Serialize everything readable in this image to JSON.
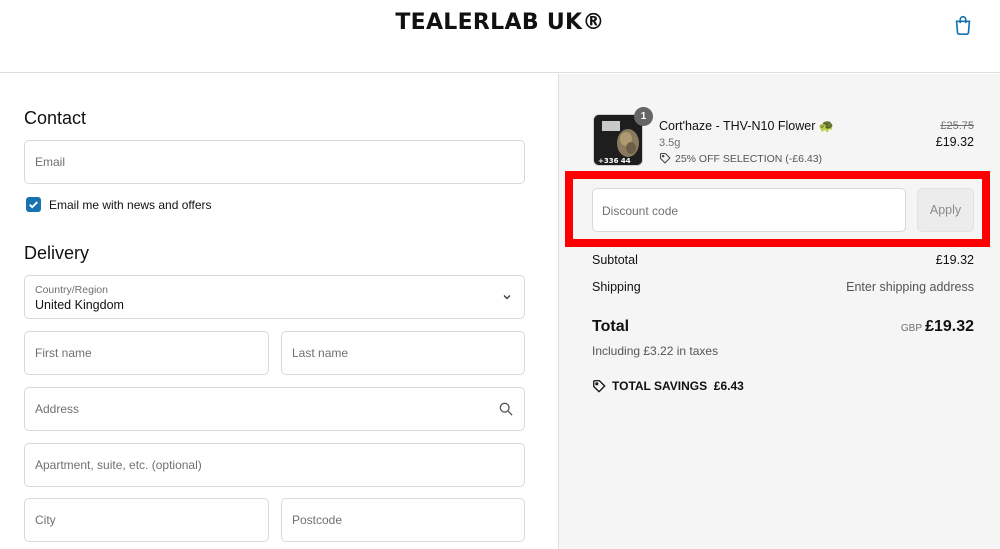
{
  "header": {
    "brand": "TEALERLAB UK®",
    "cart_icon": "shopping-bag-icon",
    "accent_color": "#1773b0"
  },
  "contact": {
    "title": "Contact",
    "email_placeholder": "Email",
    "newsletter_label": "Email me with news and offers",
    "newsletter_checked": true
  },
  "delivery": {
    "title": "Delivery",
    "country_label": "Country/Region",
    "country_value": "United Kingdom",
    "first_name_placeholder": "First name",
    "last_name_placeholder": "Last name",
    "address_placeholder": "Address",
    "apartment_placeholder": "Apartment, suite, etc. (optional)",
    "city_placeholder": "City",
    "postcode_placeholder": "Postcode"
  },
  "summary": {
    "item": {
      "quantity": "1",
      "name": "Cort'haze - THV-N10 Flower 🐢",
      "variant": "3.5g",
      "discount": "25% OFF SELECTION (-£6.43)",
      "price_original": "£25.75",
      "price_final": "£19.32",
      "thumb_text": "+336 44"
    },
    "discount_placeholder": "Discount code",
    "apply_label": "Apply",
    "subtotal_label": "Subtotal",
    "subtotal_value": "£19.32",
    "shipping_label": "Shipping",
    "shipping_value": "Enter shipping address",
    "total_label": "Total",
    "currency": "GBP",
    "total_value": "£19.32",
    "taxes_text": "Including £3.22 in taxes",
    "savings_label": "TOTAL SAVINGS",
    "savings_value": "£6.43",
    "highlight_color": "#ff0000"
  }
}
